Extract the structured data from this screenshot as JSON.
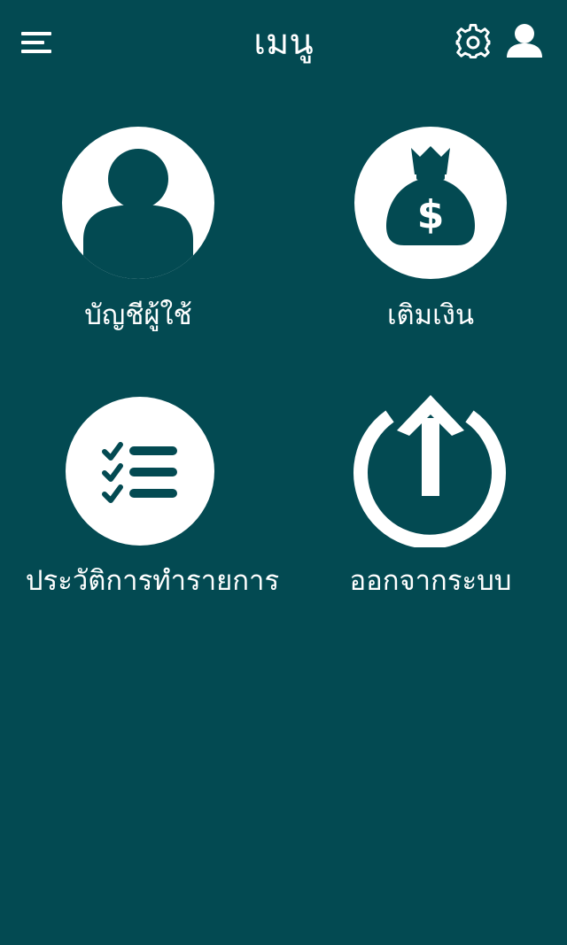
{
  "header": {
    "title": "เมนู",
    "menu_icon": "hamburger-menu-icon",
    "settings_icon": "gear-icon",
    "profile_icon": "user-icon"
  },
  "menu": {
    "items": [
      {
        "label": "บัญชีผู้ใช้",
        "icon": "user-circle-icon"
      },
      {
        "label": "เติมเงิน",
        "icon": "money-bag-icon"
      },
      {
        "label": "ประวัติการทำรายการ",
        "icon": "checklist-icon"
      },
      {
        "label": "ออกจากระบบ",
        "icon": "power-icon"
      }
    ]
  },
  "colors": {
    "background": "#034a52",
    "foreground": "#ffffff"
  }
}
